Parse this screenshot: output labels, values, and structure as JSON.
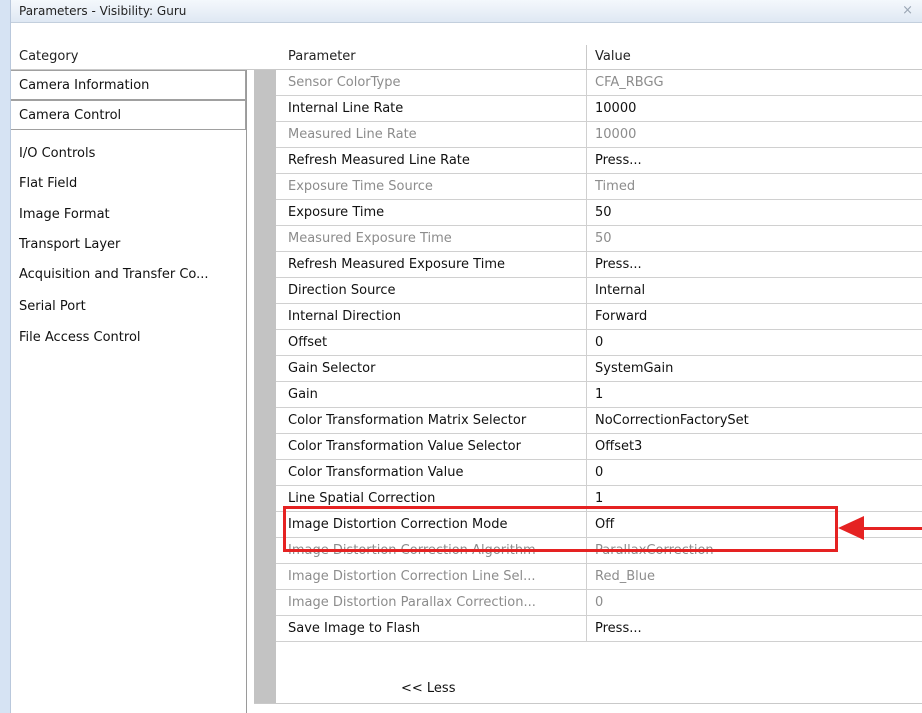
{
  "window": {
    "title": "Parameters - Visibility: Guru",
    "close_glyph": "×"
  },
  "headers": {
    "category": "Category",
    "parameter": "Parameter",
    "value": "Value"
  },
  "categories": [
    {
      "label": "Camera Information",
      "boxed": true
    },
    {
      "label": "Camera Control",
      "boxed": true,
      "selected": true
    },
    {
      "label": "I/O Controls"
    },
    {
      "label": "Flat Field"
    },
    {
      "label": "Image Format"
    },
    {
      "label": "Transport Layer"
    },
    {
      "label": "Acquisition and Transfer Co..."
    },
    {
      "label": "Serial Port"
    },
    {
      "label": "File Access Control"
    }
  ],
  "parameters": [
    {
      "name": "Sensor ColorType",
      "value": "CFA_RBGG",
      "enabled": false
    },
    {
      "name": "Internal Line Rate",
      "value": "10000",
      "enabled": true
    },
    {
      "name": "Measured Line Rate",
      "value": "10000",
      "enabled": false
    },
    {
      "name": "Refresh Measured Line Rate",
      "value": "Press...",
      "enabled": true
    },
    {
      "name": "Exposure Time Source",
      "value": "Timed",
      "enabled": false
    },
    {
      "name": "Exposure Time",
      "value": "50",
      "enabled": true
    },
    {
      "name": "Measured Exposure Time",
      "value": "50",
      "enabled": false
    },
    {
      "name": "Refresh Measured Exposure Time",
      "value": "Press...",
      "enabled": true
    },
    {
      "name": "Direction Source",
      "value": "Internal",
      "enabled": true
    },
    {
      "name": "Internal Direction",
      "value": "Forward",
      "enabled": true
    },
    {
      "name": "Offset",
      "value": "0",
      "enabled": true
    },
    {
      "name": "Gain Selector",
      "value": "SystemGain",
      "enabled": true
    },
    {
      "name": "Gain",
      "value": "1",
      "enabled": true
    },
    {
      "name": "Color Transformation Matrix Selector",
      "value": "NoCorrectionFactorySet",
      "enabled": true
    },
    {
      "name": "Color Transformation Value Selector",
      "value": "Offset3",
      "enabled": true
    },
    {
      "name": "Color Transformation Value",
      "value": "0",
      "enabled": true
    },
    {
      "name": "Line Spatial Correction",
      "value": "1",
      "enabled": true,
      "highlighted": true
    },
    {
      "name": "Image Distortion Correction Mode",
      "value": "Off",
      "enabled": true
    },
    {
      "name": "Image Distortion Correction Algorithm",
      "value": "ParallaxCorrection",
      "enabled": false
    },
    {
      "name": "Image Distortion Correction Line Sel...",
      "value": "Red_Blue",
      "enabled": false
    },
    {
      "name": "Image Distortion Parallax Correction...",
      "value": "0",
      "enabled": false
    },
    {
      "name": "Save Image to Flash",
      "value": "Press...",
      "enabled": true
    }
  ],
  "less_button": "<< Less",
  "colors": {
    "highlight": "#e52222",
    "disabled_text": "#8c8c8c",
    "titlebar": "#dfe8f3"
  }
}
